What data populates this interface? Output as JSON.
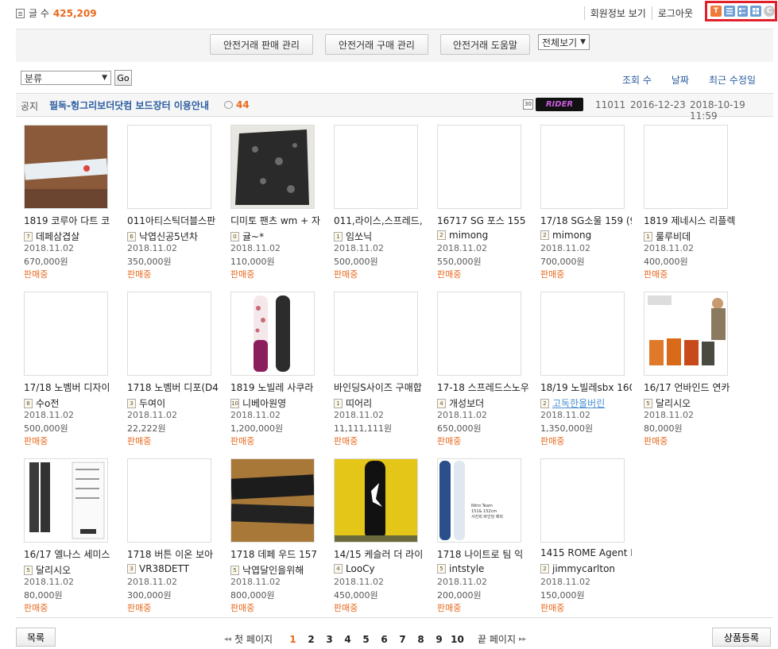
{
  "header": {
    "count_label": "글 수",
    "count_value": "425,209",
    "links": [
      "회원정보 보기",
      "로그아웃"
    ],
    "view_modes": [
      "T",
      "list-icon",
      "webzine-icon",
      "gallery-icon",
      "C"
    ]
  },
  "toolbar": {
    "buttons": [
      "안전거래 판매 관리",
      "안전거래 구매 관리",
      "안전거래 도움말"
    ],
    "filter_value": "전체보기"
  },
  "filter": {
    "category_value": "분류",
    "go_label": "Go",
    "sorts": [
      "조회 수",
      "날짜",
      "최근 수정일"
    ]
  },
  "notice": {
    "tag": "공지",
    "title": "필독-헝그리보더닷컴 보드장터 이용안내",
    "comments": "44",
    "level": "30",
    "badge": "RIDER",
    "views": "11011",
    "date": "2016-12-23",
    "modified": "2018-10-19 11:59"
  },
  "items": [
    {
      "title": "1819 코루아 다트 코",
      "seller": "데페삼겹살",
      "lv": "7",
      "date": "2018.11.02",
      "price": "670,000원",
      "status": "판매중",
      "img": "board"
    },
    {
      "title": "011아티스틱더블스판",
      "seller": "낙엽신공5년차",
      "lv": "6",
      "date": "2018.11.02",
      "price": "350,000원",
      "status": "판매중",
      "img": ""
    },
    {
      "title": "디미토 팬츠 wm + 자",
      "seller": "귤~*",
      "lv": "0",
      "date": "2018.11.02",
      "price": "110,000원",
      "status": "판매중",
      "img": "fabric"
    },
    {
      "title": "011,라이스,스프레드,",
      "seller": "임쏘닉",
      "lv": "1",
      "date": "2018.11.02",
      "price": "500,000원",
      "status": "판매중",
      "img": ""
    },
    {
      "title": "16717 SG 포스 155 (",
      "seller": "mimong",
      "lv": "2",
      "date": "2018.11.02",
      "price": "550,000원",
      "status": "판매중",
      "img": ""
    },
    {
      "title": "17/18 SG소울 159 (9",
      "seller": "mimong",
      "lv": "2",
      "date": "2018.11.02",
      "price": "700,000원",
      "status": "판매중",
      "img": ""
    },
    {
      "title": "1819 제네시스 리플렉",
      "seller": "룰루비데",
      "lv": "1",
      "date": "2018.11.02",
      "price": "400,000원",
      "status": "판매중",
      "img": ""
    },
    {
      "title": "17/18 노벰버 디자이",
      "seller": "수o전",
      "lv": "8",
      "date": "2018.11.02",
      "price": "500,000원",
      "status": "판매중",
      "img": ""
    },
    {
      "title": "1718 노벰버 디포(D4",
      "seller": "두여이",
      "lv": "3",
      "date": "2018.11.02",
      "price": "22,222원",
      "status": "판매중",
      "img": ""
    },
    {
      "title": "1819 노빌레 사쿠라",
      "seller": "니베아원영",
      "lv": "10",
      "date": "2018.11.02",
      "price": "1,200,000원",
      "status": "판매중",
      "img": "sakura"
    },
    {
      "title": "바인딩S사이즈 구매합",
      "seller": "띠어리",
      "lv": "1",
      "date": "2018.11.02",
      "price": "11,111,111원",
      "status": "판매중",
      "img": ""
    },
    {
      "title": "17-18 스프레드스노우",
      "seller": "개성보더",
      "lv": "4",
      "date": "2018.11.02",
      "price": "650,000원",
      "status": "판매중",
      "img": ""
    },
    {
      "title": "18/19 노빌레sbx 160",
      "seller": "고독한올버린",
      "lv": "2",
      "date": "2018.11.02",
      "price": "1,350,000원",
      "status": "판매중",
      "img": "",
      "link": true
    },
    {
      "title": "16/17 언바인드 연카",
      "seller": "달리시오",
      "lv": "5",
      "date": "2018.11.02",
      "price": "80,000원",
      "status": "판매중",
      "img": "jackets"
    },
    {
      "title": "16/17 엘나스 세미스",
      "seller": "달리시오",
      "lv": "5",
      "date": "2018.11.02",
      "price": "80,000원",
      "status": "판매중",
      "img": "pants"
    },
    {
      "title": "1718 버튼 이온 보아",
      "seller": "VR38DETT",
      "lv": "3",
      "date": "2018.11.02",
      "price": "300,000원",
      "status": "판매중",
      "img": ""
    },
    {
      "title": "1718 데페 우드 157",
      "seller": "낙엽달인을위해",
      "lv": "5",
      "date": "2018.11.02",
      "price": "800,000원",
      "status": "판매중",
      "img": "wood"
    },
    {
      "title": "14/15 케슬러 더 라이",
      "seller": "LooCy",
      "lv": "4",
      "date": "2018.11.02",
      "price": "450,000원",
      "status": "판매중",
      "img": "yellow"
    },
    {
      "title": "1718 나이트로 팀 익",
      "seller": "intstyle",
      "lv": "5",
      "date": "2018.11.02",
      "price": "200,000원",
      "status": "판매중",
      "img": "nitro"
    },
    {
      "title": "1415 ROME Agent D",
      "seller": "jimmycarlton",
      "lv": "2",
      "date": "2018.11.02",
      "price": "150,000원",
      "status": "판매중",
      "img": ""
    }
  ],
  "nitro_caption": [
    "Nitro Team",
    "151& 152cm",
    "사진외 바인딩 제외"
  ],
  "footer": {
    "list_label": "목록",
    "register_label": "상품등록",
    "first_label": "첫 페이지",
    "last_label": "끝 페이지",
    "pages": [
      "1",
      "2",
      "3",
      "4",
      "5",
      "6",
      "7",
      "8",
      "9",
      "10"
    ],
    "current_page": "1"
  }
}
